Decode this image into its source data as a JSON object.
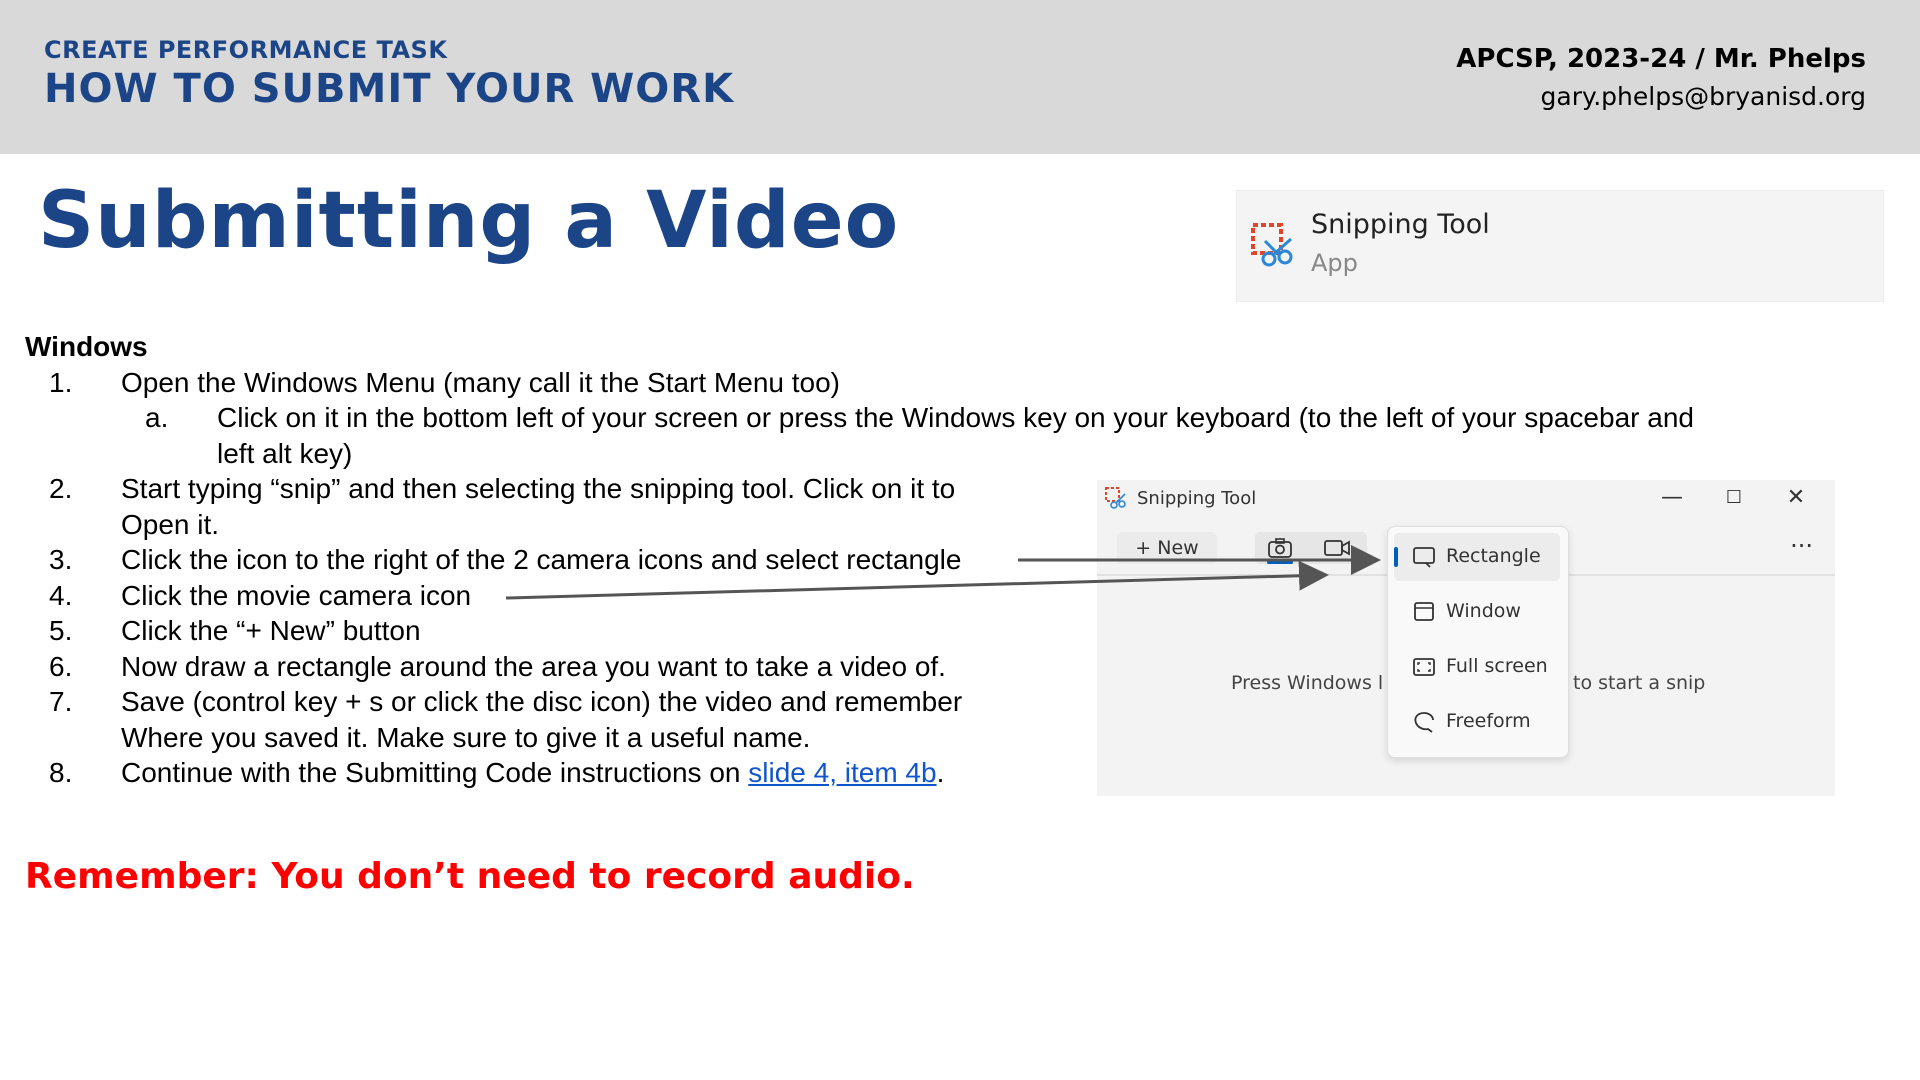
{
  "header": {
    "kicker": "CREATE PERFORMANCE TASK",
    "title": "HOW TO SUBMIT YOUR WORK",
    "course": "APCSP, 2023-24 / Mr. Phelps",
    "email": "gary.phelps@bryanisd.org"
  },
  "slide_title": "Submitting a Video",
  "search_result": {
    "app_name": "Snipping Tool",
    "app_type": "App",
    "icon": "snipping-tool-icon"
  },
  "section_heading": "Windows",
  "steps": [
    {
      "num": "1.",
      "text": "Open the Windows Menu (many call it the Start Menu too)"
    },
    {
      "num": "a.",
      "text": "Click on it in the bottom left of your screen or press the Windows key on your keyboard (to the left of your spacebar and",
      "cont": "left alt key)"
    },
    {
      "num": "2.",
      "text": "Start typing “snip” and then selecting the snipping tool. Click on it to",
      "cont": "Open it."
    },
    {
      "num": "3.",
      "text": "Click the icon to the right of the 2 camera icons and select rectangle"
    },
    {
      "num": "4.",
      "text": "Click the movie camera icon"
    },
    {
      "num": "5.",
      "text": "Click the “+ New” button"
    },
    {
      "num": "6.",
      "text": "Now draw a rectangle around the area you want to take a video of."
    },
    {
      "num": "7.",
      "text": "Save (control key + s or click the disc icon) the video and remember",
      "cont": "Where you saved it. Make sure to give it a useful name."
    },
    {
      "num": "8.",
      "text": "Continue with the Submitting Code instructions on ",
      "link": "slide 4, item 4b",
      "after": "."
    }
  ],
  "reminder": "Remember: You don’t need to record audio.",
  "snip_window": {
    "title": "Snipping Tool",
    "new_label": "+ New",
    "more_label": "···",
    "minimize": "—",
    "maximize": "☐",
    "close": "✕",
    "help_left": "Press Windows l",
    "help_right": "to start a snip",
    "menu": [
      {
        "label": "Rectangle",
        "icon": "rectangle-icon",
        "selected": true
      },
      {
        "label": "Window",
        "icon": "window-icon"
      },
      {
        "label": "Full screen",
        "icon": "full-screen-icon"
      },
      {
        "label": "Freeform",
        "icon": "freeform-icon"
      }
    ]
  },
  "colors": {
    "header_bg": "#d9d9d9",
    "brand_blue": "#1c4587",
    "reminder_red": "#ff0000",
    "link_blue": "#1155cc",
    "accent": "#005fb8"
  }
}
